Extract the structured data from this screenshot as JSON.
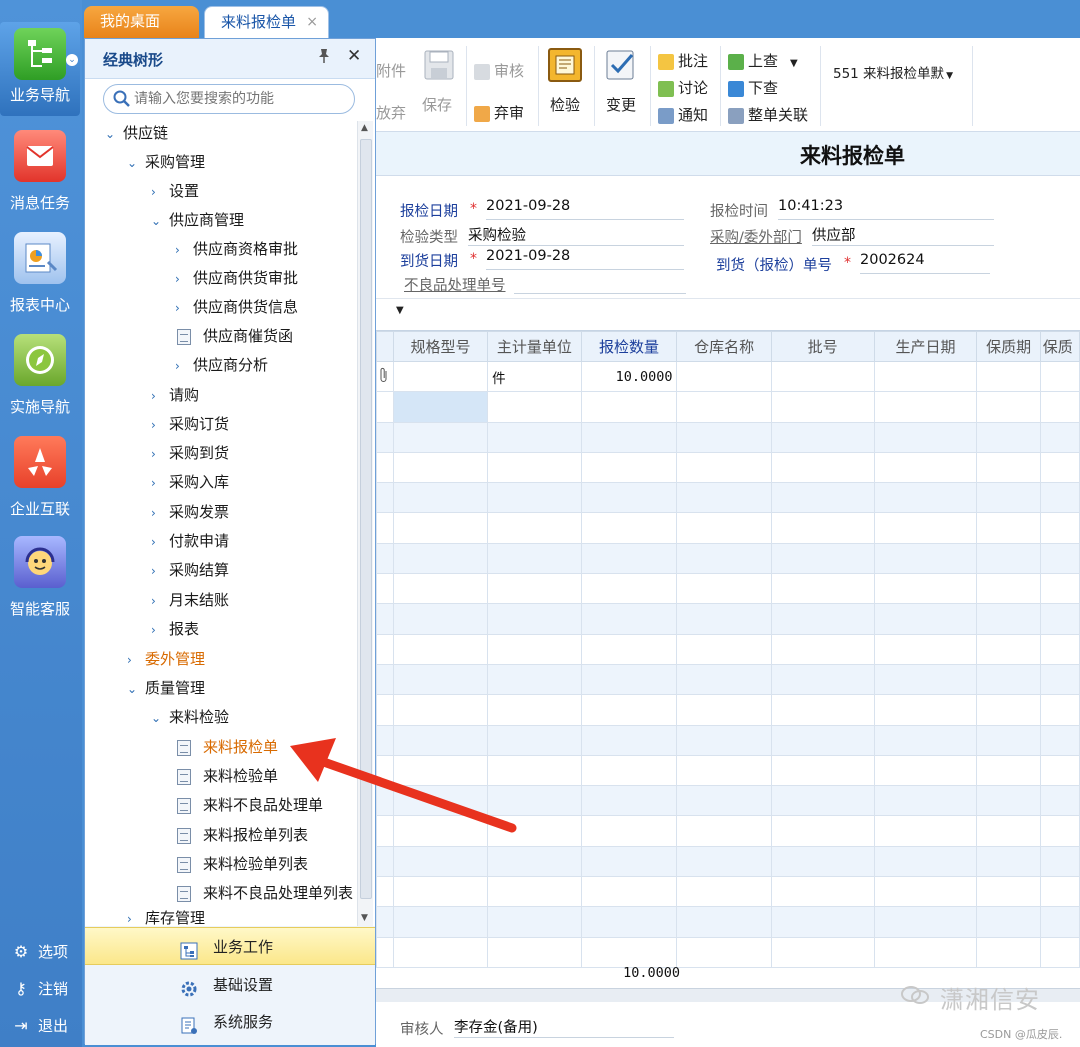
{
  "left_nav": {
    "items": [
      {
        "label": "业务导航",
        "icon": "business-nav-icon"
      },
      {
        "label": "消息任务",
        "icon": "message-task-icon"
      },
      {
        "label": "报表中心",
        "icon": "report-center-icon"
      },
      {
        "label": "实施导航",
        "icon": "implementation-nav-icon"
      },
      {
        "label": "企业互联",
        "icon": "enterprise-connect-icon"
      },
      {
        "label": "智能客服",
        "icon": "smart-service-icon"
      }
    ],
    "bottom": [
      {
        "label": "选项",
        "icon": "gear-icon"
      },
      {
        "label": "注销",
        "icon": "key-icon"
      },
      {
        "label": "退出",
        "icon": "exit-icon"
      }
    ]
  },
  "tabs": [
    {
      "label": "我的桌面"
    },
    {
      "label": "来料报检单",
      "close": "×"
    }
  ],
  "tree_panel": {
    "title": "经典树形",
    "pin": "📌",
    "close": "✕",
    "search_placeholder": "请输入您要搜索的功能",
    "nodes": [
      {
        "label": "供应链",
        "arrow": "⌄"
      },
      {
        "label": "采购管理",
        "arrow": "⌄"
      },
      {
        "label": "设置",
        "arrow": "›"
      },
      {
        "label": "供应商管理",
        "arrow": "⌄"
      },
      {
        "label": "供应商资格审批",
        "arrow": "›"
      },
      {
        "label": "供应商供货审批",
        "arrow": "›"
      },
      {
        "label": "供应商供货信息",
        "arrow": "›"
      },
      {
        "label": "供应商催货函"
      },
      {
        "label": "供应商分析",
        "arrow": "›"
      },
      {
        "label": "请购",
        "arrow": "›"
      },
      {
        "label": "采购订货",
        "arrow": "›"
      },
      {
        "label": "采购到货",
        "arrow": "›"
      },
      {
        "label": "采购入库",
        "arrow": "›"
      },
      {
        "label": "采购发票",
        "arrow": "›"
      },
      {
        "label": "付款申请",
        "arrow": "›"
      },
      {
        "label": "采购结算",
        "arrow": "›"
      },
      {
        "label": "月末结账",
        "arrow": "›"
      },
      {
        "label": "报表",
        "arrow": "›"
      },
      {
        "label": "委外管理",
        "arrow": "›"
      },
      {
        "label": "质量管理",
        "arrow": "⌄"
      },
      {
        "label": "来料检验",
        "arrow": "⌄"
      },
      {
        "label": "来料报检单"
      },
      {
        "label": "来料检验单"
      },
      {
        "label": "来料不良品处理单"
      },
      {
        "label": "来料报检单列表"
      },
      {
        "label": "来料检验单列表"
      },
      {
        "label": "来料不良品处理单列表"
      },
      {
        "label": "库存管理",
        "arrow": "›"
      }
    ],
    "bottom_tabs": [
      {
        "label": "业务工作"
      },
      {
        "label": "基础设置"
      },
      {
        "label": "系统服务"
      }
    ]
  },
  "toolbar": {
    "attach": "附件",
    "abandon": "放弃",
    "save": "保存",
    "audit": "审核",
    "unaudit": "弃审",
    "inspect": "检验",
    "change": "变更",
    "annotate": "批注",
    "discuss": "讨论",
    "notify": "通知",
    "prev": "上查",
    "next": "下查",
    "link": "整单关联",
    "template": "551 来料报检单默"
  },
  "form": {
    "title": "来料报检单",
    "fields": {
      "inspect_date_label": "报检日期",
      "inspect_date": "2021-09-28",
      "inspect_time_label": "报检时间",
      "inspect_time": "10:41:23",
      "inspect_type_label": "检验类型",
      "inspect_type": "采购检验",
      "dept_label": "采购/委外部门",
      "dept": "供应部",
      "arrival_date_label": "到货日期",
      "arrival_date": "2021-09-28",
      "arrival_no_label": "到货（报检）单号",
      "arrival_no": "2002624",
      "defect_no_label": "不良品处理单号",
      "defect_no": ""
    },
    "required_mark": "*"
  },
  "grid": {
    "columns": [
      "",
      "规格型号",
      "主计量单位",
      "报检数量",
      "仓库名称",
      "批号",
      "生产日期",
      "保质期",
      "保质"
    ],
    "rows": [
      {
        "spec": "",
        "unit": "件",
        "qty": "10.0000",
        "warehouse": "",
        "batch": "",
        "prod_date": "",
        "shelf": ""
      }
    ],
    "total_qty": "10.0000"
  },
  "footer": {
    "reviewer_label": "审核人",
    "reviewer": "李存金(备用)"
  },
  "watermark": {
    "text": "潇湘信安",
    "csdn": "CSDN @瓜皮辰."
  },
  "colors": {
    "accent_blue": "#4a8fd4",
    "tab_orange": "#e8831a",
    "highlight_orange": "#d86a00",
    "arrow_red": "#e8321e"
  }
}
